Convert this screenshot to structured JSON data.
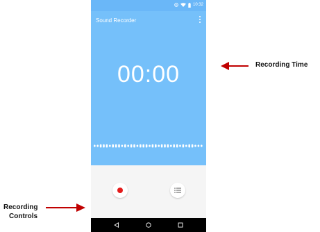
{
  "status_bar": {
    "time": "10:32"
  },
  "app": {
    "title": "Sound Recorder"
  },
  "recorder": {
    "timer": "00:00"
  },
  "annotations": {
    "recording_time": "Recording Time",
    "recording_controls_line1": "Recording",
    "recording_controls_line2": "Controls"
  },
  "colors": {
    "app_background": "#75c0fa",
    "controls_background": "#f5f5f5",
    "record_red": "#e41b1b",
    "arrow_red": "#c00000",
    "nav_bar": "#000000"
  },
  "icons": [
    "record-icon",
    "recordings-list-icon",
    "more-options-icon",
    "back-icon",
    "home-icon",
    "recents-icon",
    "wifi-icon",
    "battery-icon",
    "alarm-icon"
  ]
}
